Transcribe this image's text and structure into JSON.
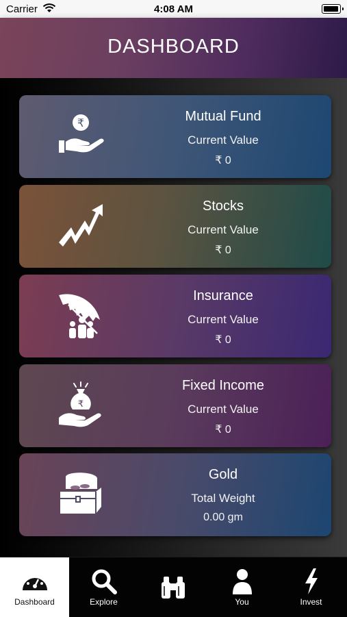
{
  "status_bar": {
    "carrier": "Carrier",
    "time": "4:08 AM"
  },
  "header": {
    "title": "DASHBOARD"
  },
  "cards": [
    {
      "name": "Mutual Fund",
      "label": "Current Value",
      "value": "₹ 0",
      "icon": "rupee-hand-icon"
    },
    {
      "name": "Stocks",
      "label": "Current Value",
      "value": "₹ 0",
      "icon": "trend-up-arrow-icon"
    },
    {
      "name": "Insurance",
      "label": "Current Value",
      "value": "₹ 0",
      "icon": "umbrella-family-icon"
    },
    {
      "name": "Fixed Income",
      "label": "Current Value",
      "value": "₹ 0",
      "icon": "money-bag-hand-icon"
    },
    {
      "name": "Gold",
      "label": "Total Weight",
      "value": "0.00 gm",
      "icon": "treasure-chest-icon"
    }
  ],
  "tabs": [
    {
      "label": "Dashboard",
      "icon": "speedometer-icon",
      "active": true
    },
    {
      "label": "Explore",
      "icon": "search-icon",
      "active": false
    },
    {
      "label": "",
      "icon": "binoculars-icon",
      "active": false
    },
    {
      "label": "You",
      "icon": "user-icon",
      "active": false
    },
    {
      "label": "Invest",
      "icon": "lightning-icon",
      "active": false
    }
  ],
  "colors": {
    "header_accent": "#4f2c5e",
    "background": "#000000",
    "active_tab_bg": "#ffffff"
  }
}
